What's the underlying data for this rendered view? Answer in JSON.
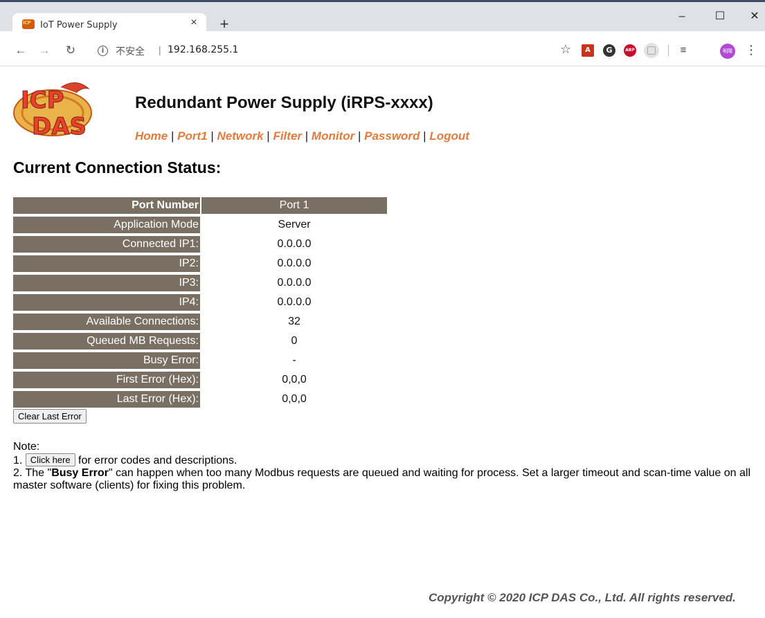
{
  "browser": {
    "tab_title": "IoT Power Supply",
    "tab_close": "×",
    "new_tab": "+",
    "insecure_label": "不安全",
    "url": "192.168.255.1",
    "avatar_text": "明陽",
    "window_buttons": {
      "minimize": "–",
      "maximize": "☐",
      "close": "✕"
    }
  },
  "header": {
    "logo_text": [
      "ICP",
      "DAS"
    ],
    "title": "Redundant Power Supply (iRPS-xxxx)",
    "nav": [
      "Home",
      "Port1",
      "Network",
      "Filter",
      "Monitor",
      "Password",
      "Logout"
    ]
  },
  "main": {
    "heading": "Current Connection Status:",
    "table": {
      "header": {
        "label": "Port Number",
        "value": "Port 1"
      },
      "rows": [
        {
          "label": "Application Mode",
          "value": "Server"
        },
        {
          "label": "Connected IP1:",
          "value": "0.0.0.0"
        },
        {
          "label": "IP2:",
          "value": "0.0.0.0"
        },
        {
          "label": "IP3:",
          "value": "0.0.0.0"
        },
        {
          "label": "IP4:",
          "value": "0.0.0.0"
        },
        {
          "label": "Available Connections:",
          "value": "32"
        },
        {
          "label": "Queued MB Requests:",
          "value": "0"
        },
        {
          "label": "Busy Error:",
          "value": "-"
        },
        {
          "label": "First Error (Hex):",
          "value": "0,0,0"
        },
        {
          "label": "Last Error (Hex):",
          "value": "0,0,0"
        }
      ]
    },
    "clear_button": "Clear Last Error",
    "notes": {
      "title": "Note:",
      "item1_prefix": "1.",
      "item1_button": "Click here",
      "item1_text": "for error codes and descriptions.",
      "item2_prefix": "2. The \"",
      "item2_bold": "Busy Error",
      "item2_text": "\" can happen when too many Modbus requests are queued and waiting for process. Set a larger timeout and scan-time value on all master software (clients) for fixing this problem."
    }
  },
  "footer": {
    "copyright": "Copyright © 2020 ICP DAS Co., Ltd. All rights reserved."
  },
  "colors": {
    "table_bg": "#7a6f63",
    "nav_link": "#e27b3c"
  }
}
